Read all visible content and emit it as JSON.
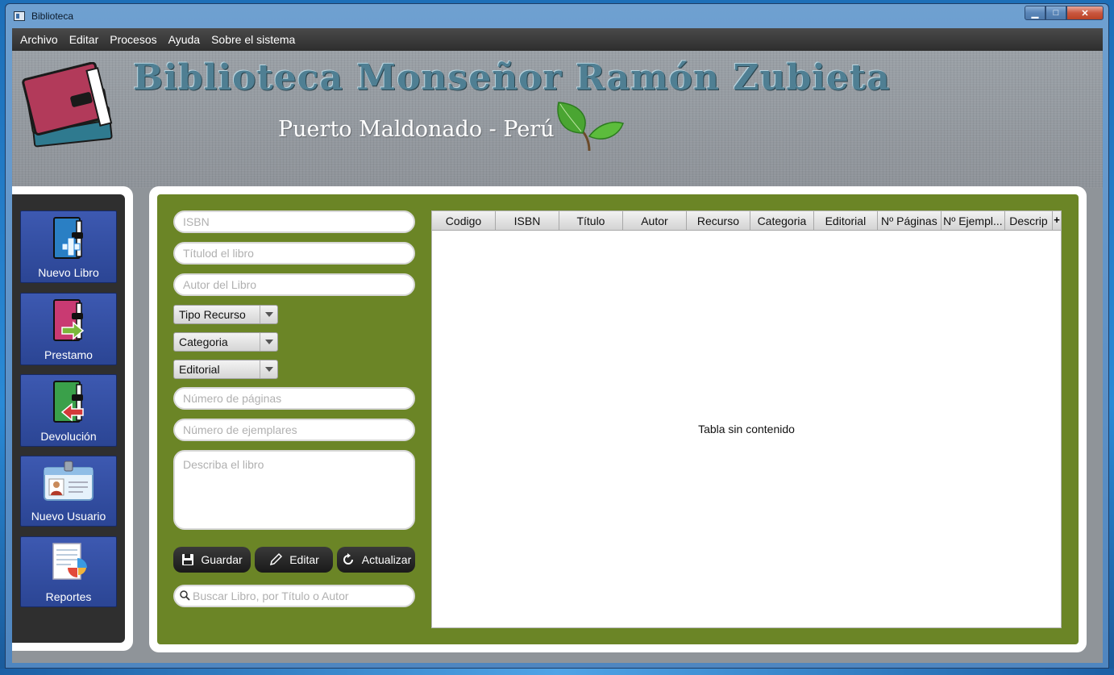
{
  "window": {
    "title": "Biblioteca",
    "controls": {
      "minimize": "▁",
      "maximize": "□",
      "close": "✕"
    }
  },
  "menu": {
    "items": [
      "Archivo",
      "Editar",
      "Procesos",
      "Ayuda",
      "Sobre el sistema"
    ]
  },
  "header": {
    "title": "Biblioteca Monseñor Ramón Zubieta",
    "subtitle": "Puerto Maldonado - Perú"
  },
  "sidebar": {
    "items": [
      {
        "label": "Nuevo Libro",
        "icon": "book-add-icon"
      },
      {
        "label": "Prestamo",
        "icon": "book-lend-icon"
      },
      {
        "label": "Devolución",
        "icon": "book-return-icon"
      },
      {
        "label": "Nuevo Usuario",
        "icon": "user-card-icon"
      },
      {
        "label": "Reportes",
        "icon": "report-icon"
      }
    ]
  },
  "form": {
    "isbn_placeholder": "ISBN",
    "title_placeholder": "Títulod el libro",
    "author_placeholder": "Autor del Libro",
    "tipo_recurso": "Tipo Recurso",
    "categoria": "Categoria",
    "editorial": "Editorial",
    "pages_placeholder": "Número de páginas",
    "copies_placeholder": "Número de ejemplares",
    "description_placeholder": "Describa el libro",
    "buttons": {
      "save": "Guardar",
      "edit": "Editar",
      "refresh": "Actualizar"
    },
    "search_placeholder": "Buscar Libro, por Título o Autor"
  },
  "table": {
    "columns": [
      "Codigo",
      "ISBN",
      "Título",
      "Autor",
      "Recurso",
      "Categoria",
      "Editorial",
      "Nº Páginas",
      "Nº Ejempl...",
      "Descrip"
    ],
    "add_column": "+",
    "empty_message": "Tabla sin contenido"
  },
  "colors": {
    "panel_green": "#6b8526",
    "sidebar_button": "#3d59b1",
    "title_color": "#4f7f93"
  }
}
